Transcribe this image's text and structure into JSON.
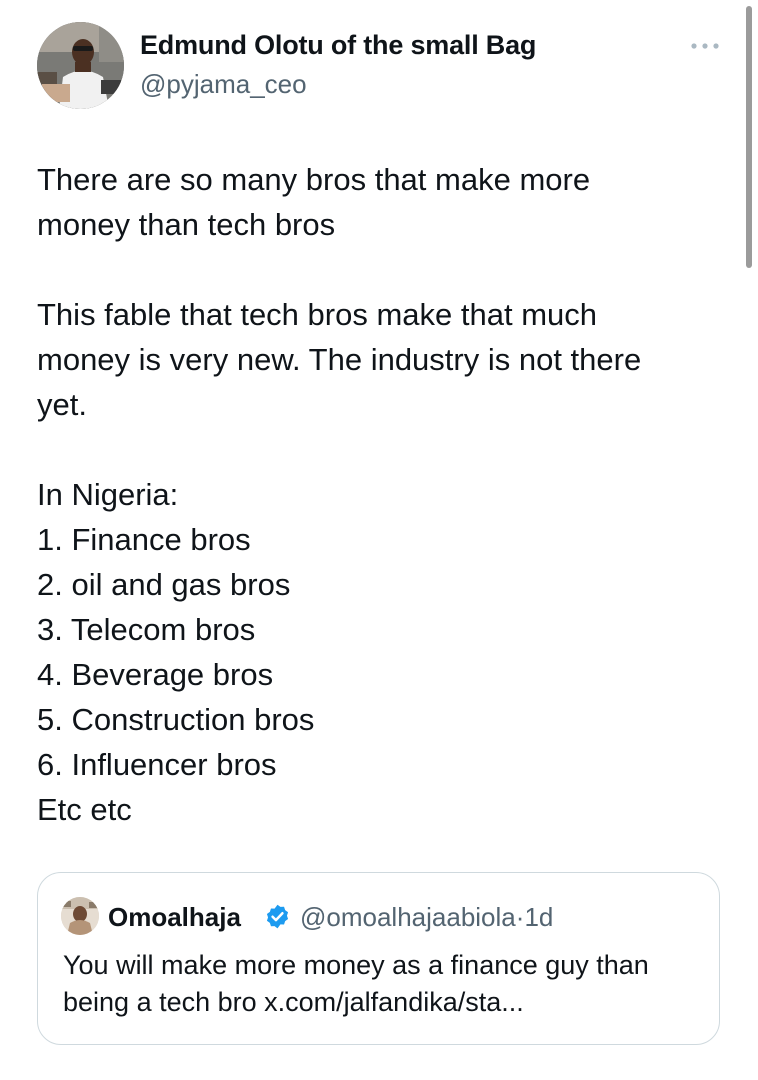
{
  "author": {
    "display_name": "Edmund Olotu of the small Bag",
    "handle": "@pyjama_ceo",
    "avatar_icon": "profile-photo"
  },
  "actions": {
    "more_icon": "more-horizontal-icon"
  },
  "tweet": {
    "lines": [
      "There are so many bros that make more",
      "money than tech bros",
      "",
      "This fable that tech bros make that much",
      "money is very new. The industry is not there",
      "yet.",
      "",
      "In Nigeria:",
      "1. Finance bros",
      "2. oil and gas bros",
      "3. Telecom bros",
      "4. Beverage bros",
      "5. Construction bros",
      "6. Influencer bros",
      "Etc etc"
    ]
  },
  "quoted_tweet": {
    "display_name": "Omoalhaja",
    "verified": true,
    "verified_color": "#1d9bf0",
    "handle": "@omoalhajaabiola",
    "separator": "·",
    "time": "1d",
    "lines": [
      "You will make more money as a finance guy than",
      "being a tech bro x.com/jalfandika/sta..."
    ]
  },
  "colors": {
    "text_primary": "#0f1419",
    "text_secondary": "#536471",
    "border": "#cfd9de",
    "background": "#ffffff"
  }
}
